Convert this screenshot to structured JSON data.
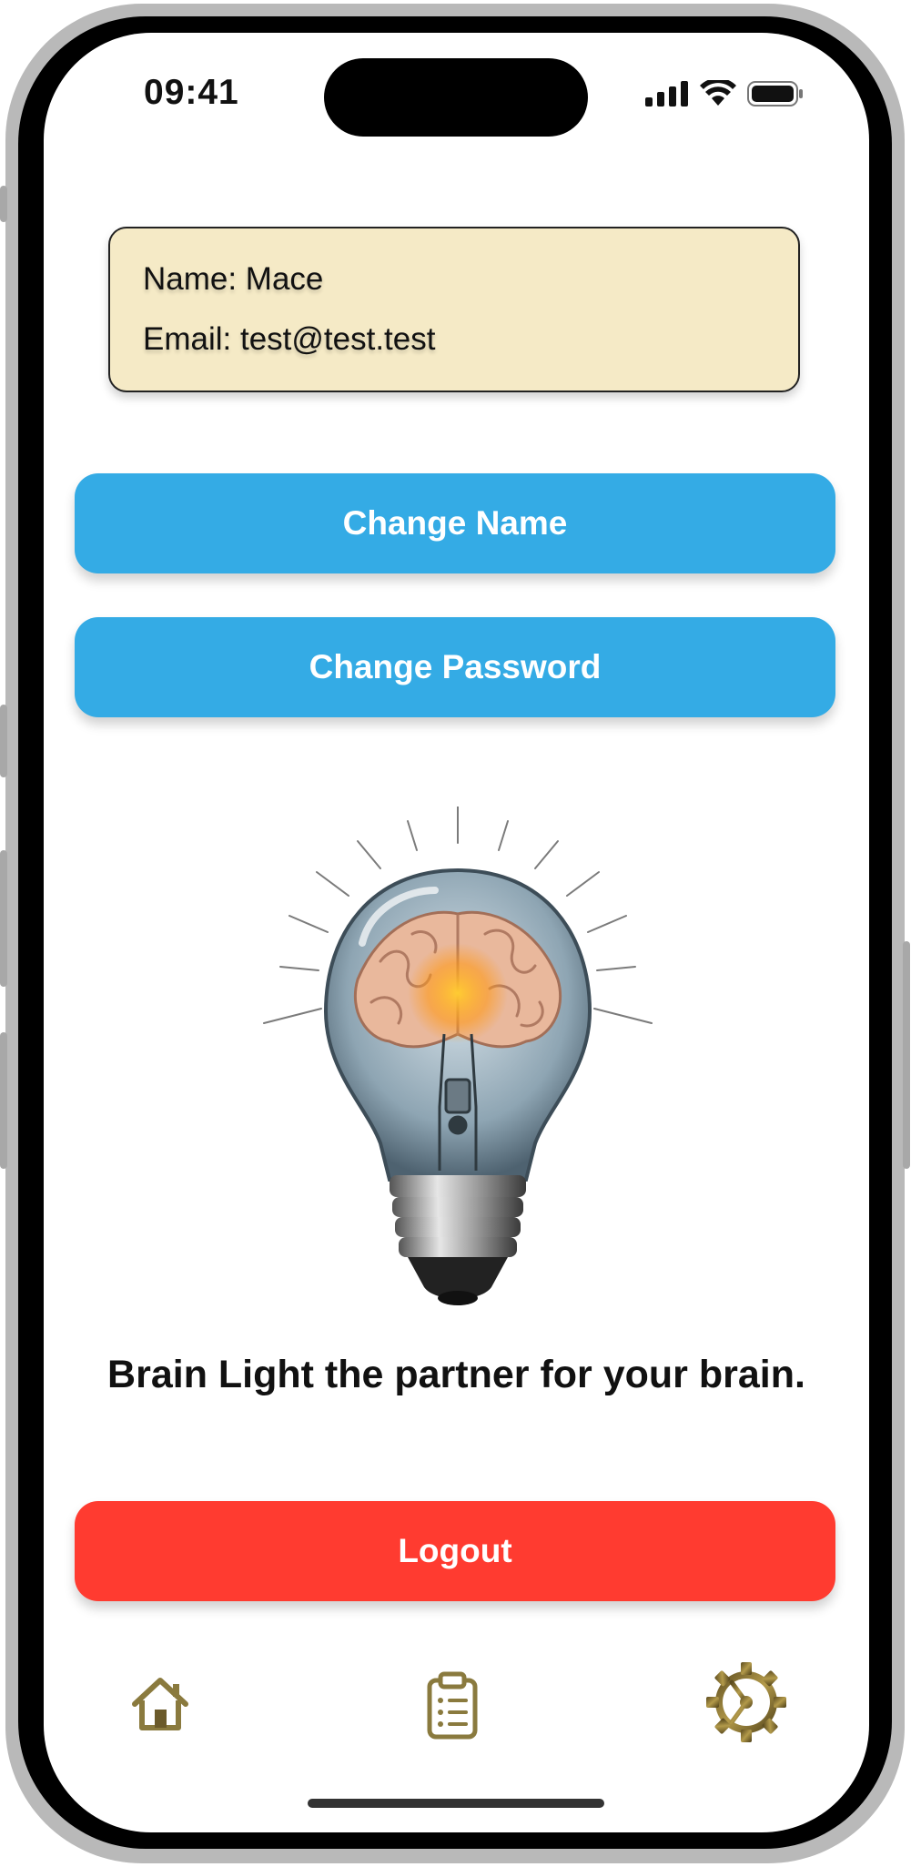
{
  "status_bar": {
    "time": "09:41"
  },
  "profile": {
    "name_line": "Name: Mace",
    "email_line": "Email: test@test.test"
  },
  "buttons": {
    "change_name": "Change Name",
    "change_password": "Change Password",
    "logout": "Logout"
  },
  "tagline": "Brain Light the partner for your brain.",
  "tab_bar": {
    "items": [
      {
        "icon": "home-icon"
      },
      {
        "icon": "clipboard-list-icon"
      },
      {
        "icon": "gear-icon",
        "selected": true
      }
    ]
  },
  "colors": {
    "card_bg": "#f5eac6",
    "primary_button": "#34abe5",
    "logout_button": "#ff3b30",
    "tab_icon": "#8a7a3e"
  }
}
